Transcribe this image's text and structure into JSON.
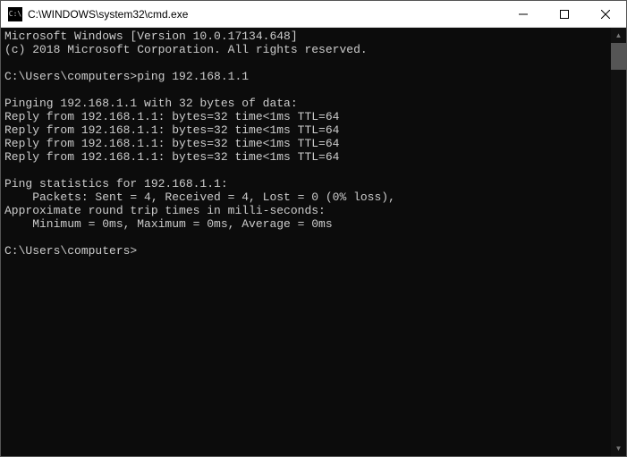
{
  "titlebar": {
    "icon_label": "C:\\",
    "title": "C:\\WINDOWS\\system32\\cmd.exe"
  },
  "terminal": {
    "lines": [
      "Microsoft Windows [Version 10.0.17134.648]",
      "(c) 2018 Microsoft Corporation. All rights reserved.",
      "",
      "C:\\Users\\computers>ping 192.168.1.1",
      "",
      "Pinging 192.168.1.1 with 32 bytes of data:",
      "Reply from 192.168.1.1: bytes=32 time<1ms TTL=64",
      "Reply from 192.168.1.1: bytes=32 time<1ms TTL=64",
      "Reply from 192.168.1.1: bytes=32 time<1ms TTL=64",
      "Reply from 192.168.1.1: bytes=32 time<1ms TTL=64",
      "",
      "Ping statistics for 192.168.1.1:",
      "    Packets: Sent = 4, Received = 4, Lost = 0 (0% loss),",
      "Approximate round trip times in milli-seconds:",
      "    Minimum = 0ms, Maximum = 0ms, Average = 0ms",
      "",
      "C:\\Users\\computers>"
    ]
  }
}
